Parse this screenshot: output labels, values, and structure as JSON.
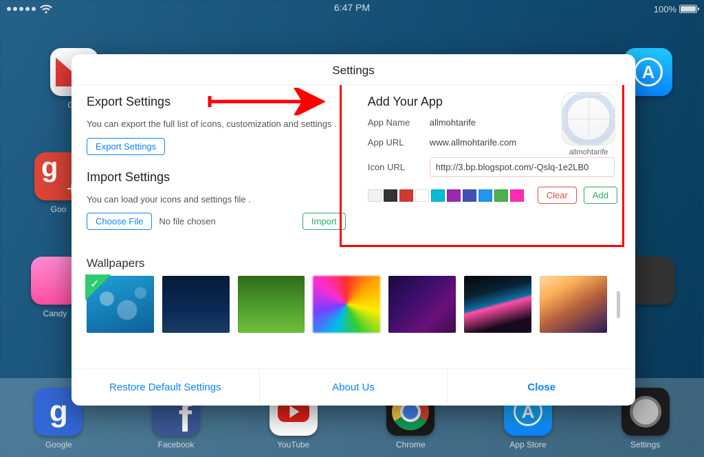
{
  "status_bar": {
    "time": "6:47 PM",
    "battery_pct": "100%"
  },
  "bg_apps": {
    "gmail": "Gm",
    "gplus": "Goo",
    "candy": "Candy",
    "appstore": "",
    "camera": ""
  },
  "dock": {
    "google": "Google",
    "facebook": "Facebook",
    "youtube": "YouTube",
    "chrome": "Chrome",
    "appstore": "App Store",
    "settings": "Settings"
  },
  "modal": {
    "title": "Settings",
    "export": {
      "heading": "Export Settings",
      "note": "You can export the full list of icons, customization and settings .",
      "button": "Export Settings"
    },
    "import": {
      "heading": "Import Settings",
      "note": "You can load your icons and settings file .",
      "choose": "Choose File",
      "no_file": "No file chosen",
      "import_btn": "Import"
    },
    "add_app": {
      "heading": "Add Your App",
      "name_label": "App Name",
      "name_value": "allmohtarife",
      "url_label": "App URL",
      "url_value": "www.allmohtarife.com",
      "icon_label": "Icon URL",
      "icon_value": "http://3.bp.blogspot.com/-Qslq-1e2LB0",
      "preview_label": "allmohtarife",
      "clear": "Clear",
      "add": "Add",
      "swatches": [
        "#f2f2f2",
        "#333333",
        "#d33a2f",
        "#ffffff",
        "#00bcd4",
        "#9c27b0",
        "#3f51b5",
        "#2196f3",
        "#4caf50",
        "#ff2db1"
      ]
    },
    "wallpapers": {
      "heading": "Wallpapers"
    },
    "footer": {
      "restore": "Restore Default Settings",
      "about": "About Us",
      "close": "Close"
    }
  }
}
